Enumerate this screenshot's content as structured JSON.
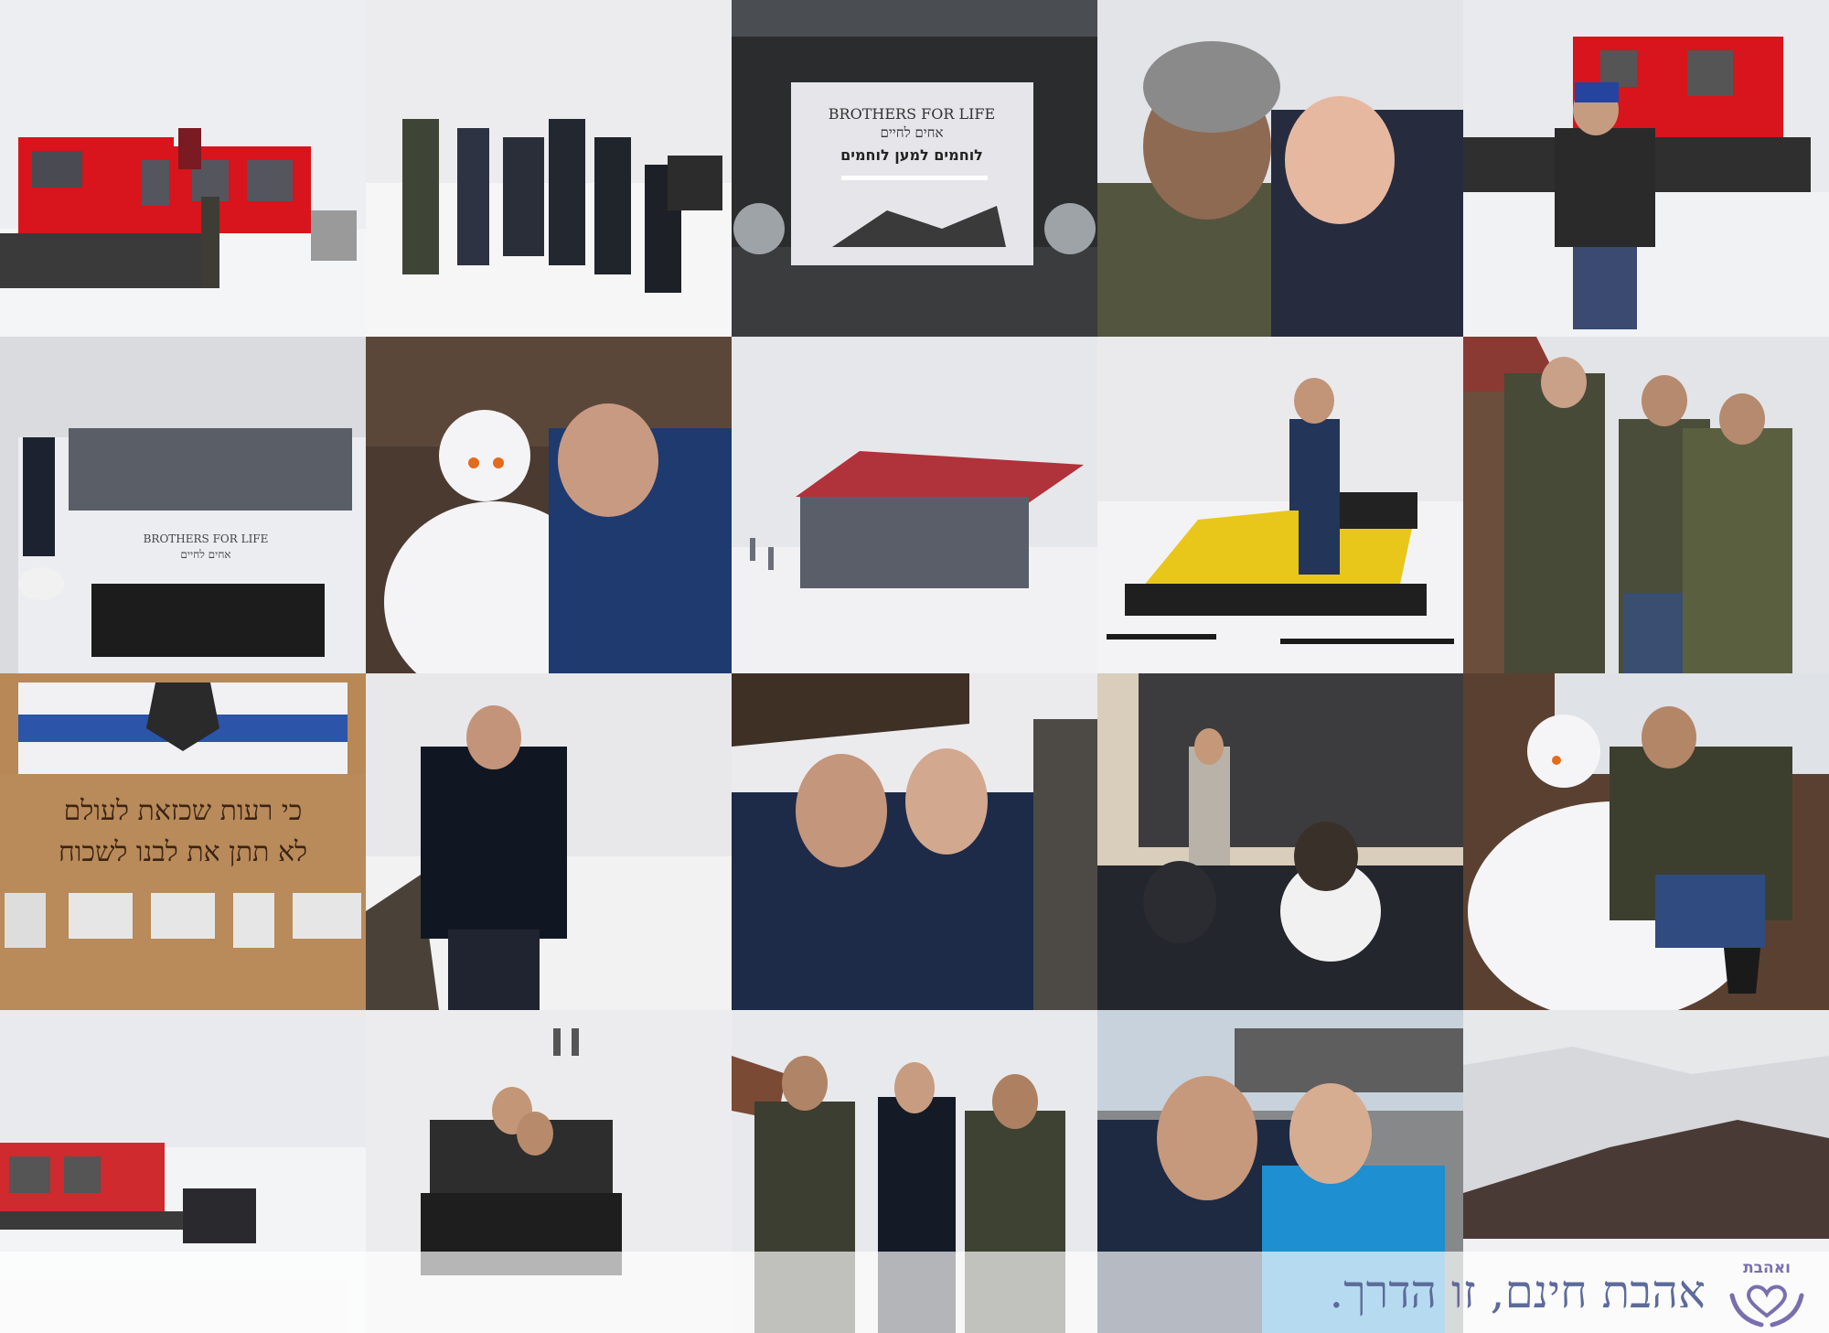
{
  "slogan": "אהבת חינם, זו הדרך.",
  "logo": {
    "word": "ואהבת",
    "icon": "hands-heart-icon"
  },
  "photo_signs": {
    "bus_sign_en": "BROTHERS FOR LIFE",
    "bus_sign_he": "אחים לחיים",
    "bus_sign_sub": "לוחמים למען לוחמים",
    "van_logo_en": "BROTHERS FOR LIFE",
    "van_logo_he": "אחים לחיים",
    "memorial_line1": "כי רעות שכזאת לעולם",
    "memorial_line2": "לא תתן את לבנו לשכוח",
    "jacket_logo": "aztec"
  },
  "colors": {
    "slogan": "#5d6b9a",
    "logo": "#7a6fae",
    "snow": "#eef0f2",
    "snowcat_red": "#d8141c"
  }
}
